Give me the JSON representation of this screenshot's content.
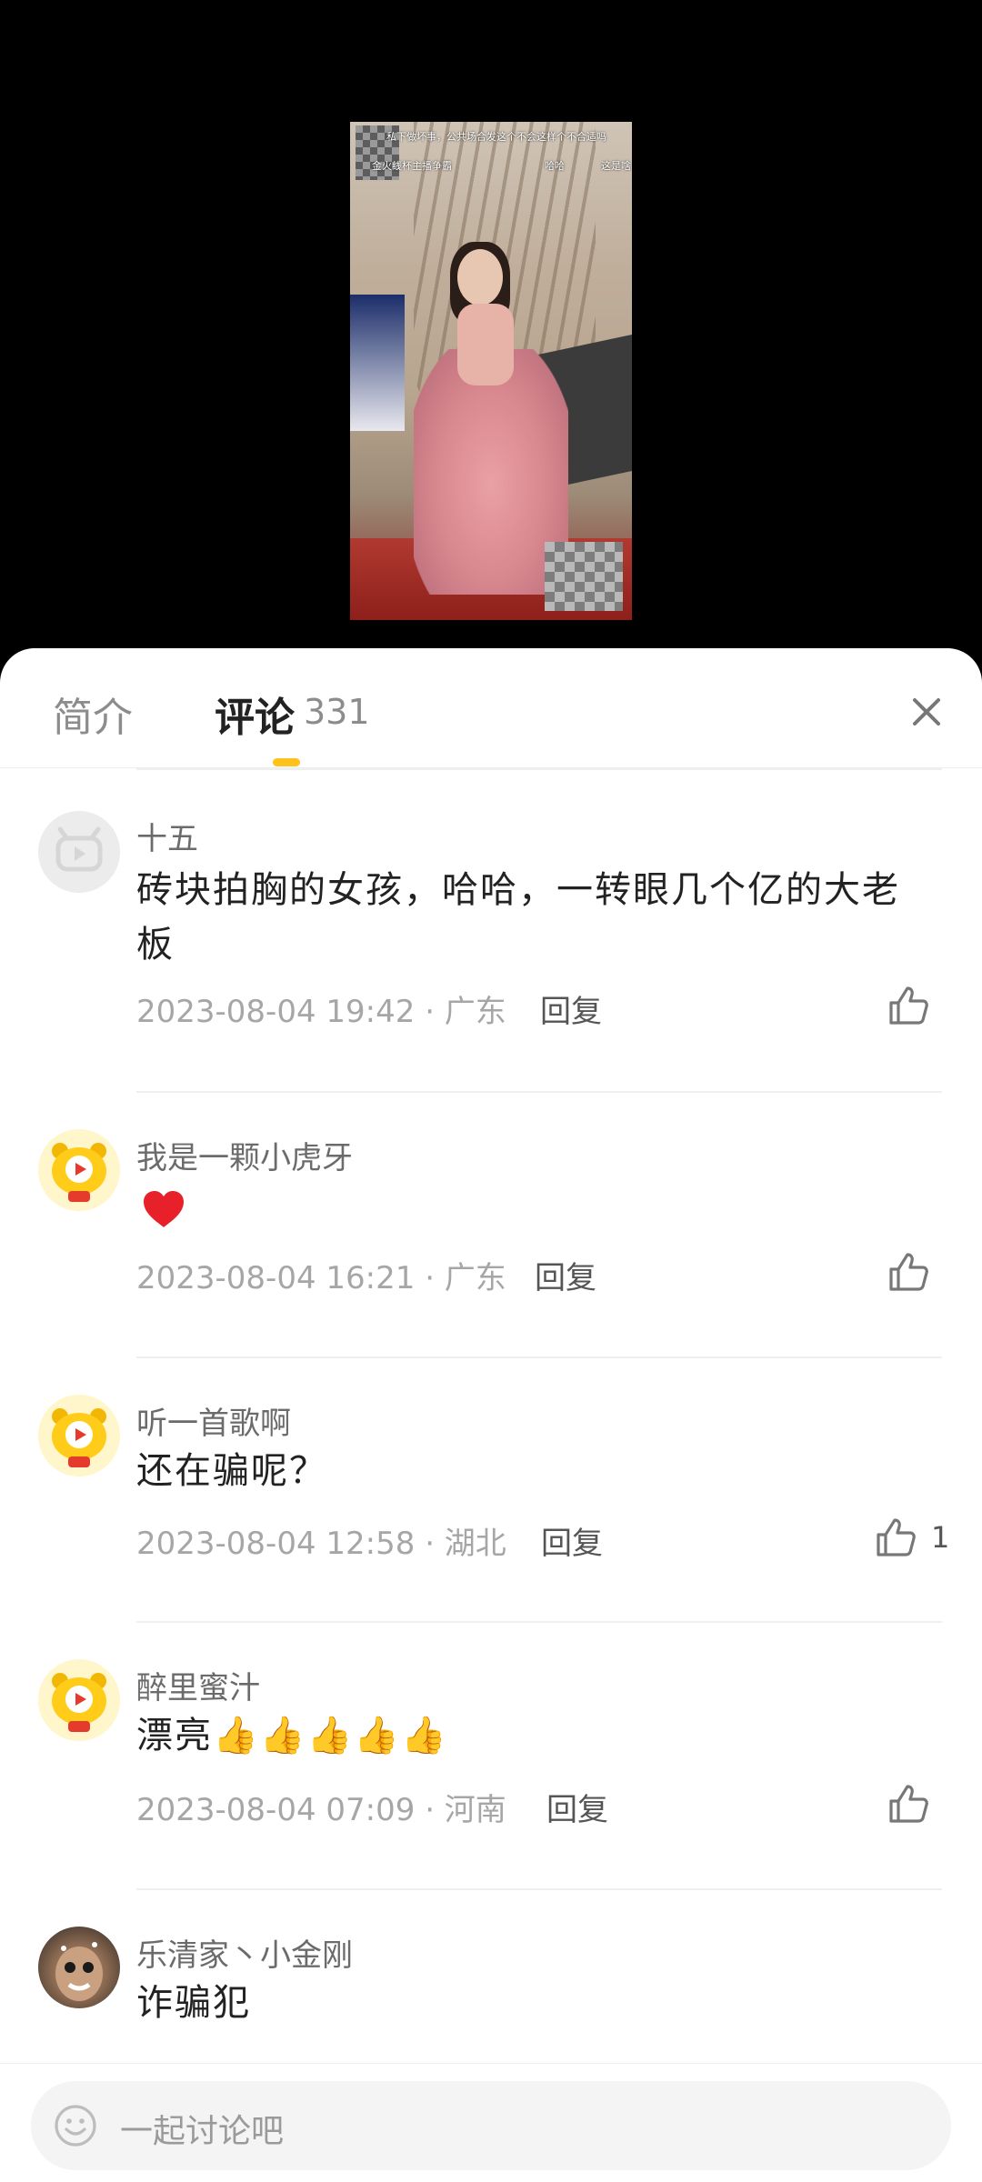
{
  "video": {
    "caption_line1": "私下做坏事，公共场合发这个不会这样个不合适吗",
    "caption_line2": "金火线杯主播争霸",
    "caption_line3": "哈哈",
    "caption_line4": "这是啥"
  },
  "tabs": {
    "intro_label": "简介",
    "comments_label": "评论",
    "comments_count": "331"
  },
  "comments": [
    {
      "username": "十五",
      "content": "砖块拍胸的女孩，哈哈，一转眼几个亿的大老板",
      "time_location": "2023-08-04 19:42 · 广东",
      "reply_label": "回复",
      "likes": ""
    },
    {
      "username": "我是一颗小虎牙",
      "content": "❤️",
      "time_location": "2023-08-04 16:21 · 广东",
      "reply_label": "回复",
      "likes": ""
    },
    {
      "username": "听一首歌啊",
      "content": "还在骗呢？",
      "time_location": "2023-08-04 12:58 · 湖北",
      "reply_label": "回复",
      "likes": "1"
    },
    {
      "username": "醉里蜜汁",
      "content": "漂亮👍👍👍👍👍",
      "time_location": "2023-08-04 07:09 · 河南",
      "reply_label": "回复",
      "likes": ""
    },
    {
      "username": "乐清家丶小金刚",
      "content": "诈骗犯",
      "time_location": "",
      "reply_label": "",
      "likes": ""
    }
  ],
  "input": {
    "placeholder": "一起讨论吧"
  },
  "colors": {
    "accent": "#ffc21a",
    "heart": "#e8202a"
  }
}
